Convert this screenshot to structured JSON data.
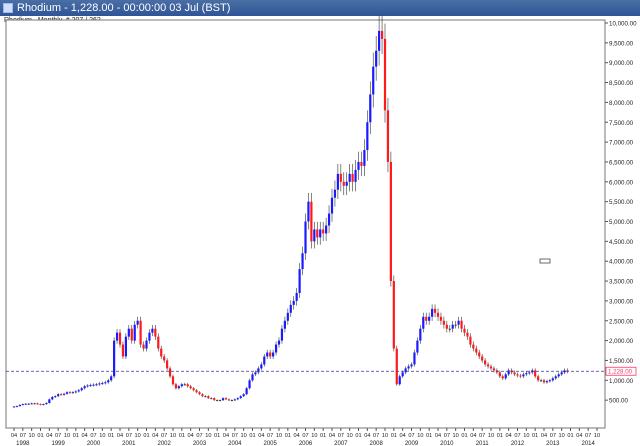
{
  "window": {
    "title": "Rhodium - 1,228.00 - 00:00:00  03 Jul (BST)",
    "subtitle": "Rhodium , Monthly, # 207 / 262"
  },
  "chart_data": {
    "type": "candlestick",
    "title": "Rhodium",
    "interval": "Monthly",
    "current_price_label": "1,228.00",
    "current_price": 1228,
    "ylim": [
      0,
      10000
    ],
    "y_ticks": [
      500,
      1000,
      1500,
      2000,
      2500,
      3000,
      3500,
      4000,
      4500,
      5000,
      5500,
      6000,
      6500,
      7000,
      7500,
      8000,
      8500,
      9000,
      9500,
      10000
    ],
    "y_tick_labels": [
      "500.00",
      "1,000.00",
      "1,500.00",
      "2,000.00",
      "2,500.00",
      "3,000.00",
      "3,500.00",
      "4,000.00",
      "4,500.00",
      "5,000.00",
      "5,500.00",
      "6,000.00",
      "6,500.00",
      "7,000.00",
      "7,500.00",
      "8,000.00",
      "8,500.00",
      "9,000.00",
      "9,500.00",
      "10,000.00"
    ],
    "x_start": "1998-04",
    "x_end": "2014-10",
    "years": [
      "1998",
      "1999",
      "2000",
      "2001",
      "2002",
      "2003",
      "2004",
      "2005",
      "2006",
      "2007",
      "2008",
      "2009",
      "2010",
      "2011",
      "2012",
      "2013",
      "2014"
    ],
    "month_ticks": [
      "04",
      "07",
      "10",
      "01"
    ],
    "colors": {
      "up": "#1a1aff",
      "down": "#ff1a1a",
      "neutral": "#333333",
      "price_line": "#3333aa",
      "price_box": "#ff3366"
    },
    "closes": [
      340,
      350,
      380,
      400,
      410,
      410,
      420,
      420,
      400,
      390,
      400,
      430,
      520,
      580,
      600,
      650,
      640,
      660,
      700,
      690,
      700,
      720,
      750,
      800,
      850,
      870,
      880,
      890,
      900,
      920,
      930,
      950,
      1000,
      1100,
      2000,
      2200,
      1900,
      1600,
      2100,
      2300,
      2000,
      2400,
      2500,
      1900,
      1800,
      2000,
      2200,
      2300,
      2100,
      1800,
      1600,
      1500,
      1300,
      1100,
      900,
      800,
      850,
      900,
      900,
      850,
      800,
      750,
      700,
      650,
      600,
      600,
      550,
      550,
      500,
      500,
      500,
      550,
      520,
      500,
      500,
      520,
      550,
      600,
      650,
      800,
      1000,
      1150,
      1200,
      1300,
      1400,
      1600,
      1700,
      1600,
      1700,
      1900,
      2000,
      2300,
      2500,
      2700,
      2900,
      3000,
      3200,
      3800,
      4200,
      5000,
      5500,
      4500,
      4800,
      4600,
      4800,
      4700,
      4900,
      5200,
      5600,
      5800,
      6200,
      6000,
      5900,
      6000,
      6200,
      6000,
      6300,
      6500,
      6400,
      6800,
      7500,
      8200,
      8900,
      9300,
      9800,
      9600,
      7800,
      6500,
      3500,
      1800,
      900,
      1100,
      1200,
      1300,
      1350,
      1400,
      1700,
      2000,
      2300,
      2600,
      2500,
      2600,
      2800,
      2700,
      2600,
      2500,
      2400,
      2300,
      2300,
      2400,
      2400,
      2500,
      2300,
      2200,
      2100,
      1900,
      1800,
      1700,
      1600,
      1500,
      1400,
      1350,
      1300,
      1250,
      1200,
      1100,
      1050,
      1150,
      1250,
      1200,
      1150,
      1120,
      1100,
      1150,
      1180,
      1200,
      1250,
      1100,
      1000,
      1000,
      950,
      980,
      1000,
      1050,
      1100,
      1150,
      1200,
      1250,
      1228
    ]
  }
}
